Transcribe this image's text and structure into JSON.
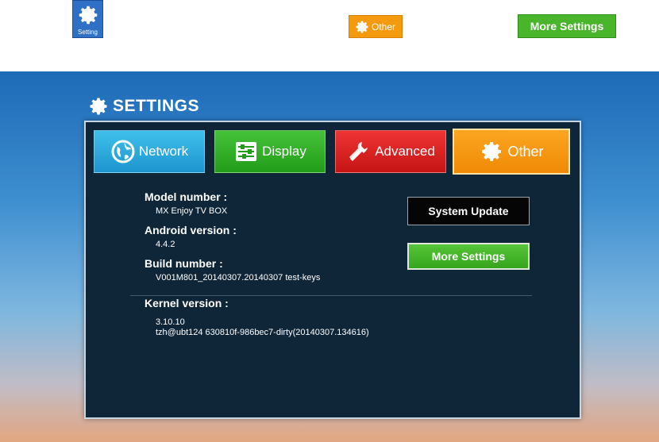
{
  "top_strip": {
    "setting_app_label": "Setting",
    "other_label": "Other",
    "more_settings_label": "More Settings"
  },
  "screen": {
    "title": "SETTINGS",
    "tabs": [
      {
        "label": "Network",
        "icon": "globe-icon",
        "color": "#1d95cf"
      },
      {
        "label": "Display",
        "icon": "sliders-icon",
        "color": "#229d19"
      },
      {
        "label": "Advanced",
        "icon": "tools-icon",
        "color": "#c51414"
      },
      {
        "label": "Other",
        "icon": "gear-icon",
        "color": "#f08a05"
      }
    ],
    "info": {
      "model_label": "Model number :",
      "model_value": "MX Enjoy TV BOX",
      "android_label": "Android version :",
      "android_value": "4.4.2",
      "build_label": "Build number :",
      "build_value": "V001M801_20140307.20140307 test-keys",
      "kernel_label": "Kernel version :",
      "kernel_value_1": "3.10.10",
      "kernel_value_2": "tzh@ubt124 630810f-986bec7-dirty(20140307.134616)"
    },
    "buttons": {
      "system_update": "System Update",
      "more_settings": "More Settings"
    }
  }
}
